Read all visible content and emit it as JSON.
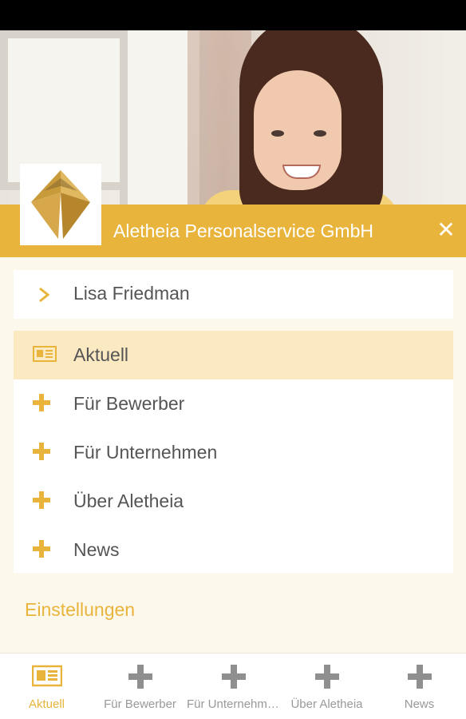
{
  "header": {
    "company_name": "Aletheia Personalservice GmbH",
    "close_label": "✕"
  },
  "user": {
    "name": "Lisa Friedman"
  },
  "menu": {
    "items": [
      {
        "label": "Aktuell",
        "icon": "newspaper-icon",
        "active": true
      },
      {
        "label": "Für Bewerber",
        "icon": "plus-icon",
        "active": false
      },
      {
        "label": "Für Unternehmen",
        "icon": "plus-icon",
        "active": false
      },
      {
        "label": "Über Aletheia",
        "icon": "plus-icon",
        "active": false
      },
      {
        "label": "News",
        "icon": "plus-icon",
        "active": false
      }
    ]
  },
  "settings_label": "Einstellungen",
  "tabs": [
    {
      "label": "Aktuell",
      "icon": "newspaper-icon",
      "active": true
    },
    {
      "label": "Für Bewerber",
      "icon": "plus-icon",
      "active": false
    },
    {
      "label": "Für Unternehmen",
      "icon": "plus-icon",
      "active": false
    },
    {
      "label": "Über Aletheia",
      "icon": "plus-icon",
      "active": false
    },
    {
      "label": "News",
      "icon": "plus-icon",
      "active": false
    }
  ],
  "colors": {
    "accent": "#e8b43c",
    "active_row": "#fbe9c2",
    "background": "#fdf8ec",
    "tab_icon": "#8f8f8f"
  }
}
